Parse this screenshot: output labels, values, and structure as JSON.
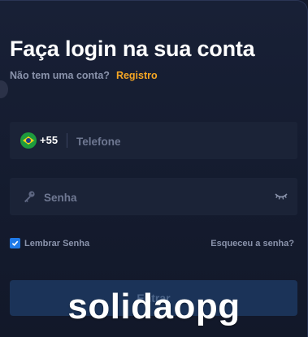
{
  "header": {
    "title": "Faça login na sua conta",
    "no_account_text": "Não tem uma conta?",
    "register_link": "Registro"
  },
  "phone_field": {
    "country_flag": "brazil-flag-icon",
    "dial_code": "+55",
    "placeholder": "Telefone"
  },
  "password_field": {
    "placeholder": "Senha",
    "lead_icon": "key-icon",
    "toggle_icon": "eye-closed-icon"
  },
  "options": {
    "remember_label": "Lembrar Senha",
    "remember_checked": true,
    "forgot_link": "Esqueceu a senha?"
  },
  "submit": {
    "label": "Entrar"
  },
  "watermark": "solidaopg",
  "colors": {
    "accent": "#f5a623",
    "checkbox": "#1f7ae8",
    "background": "#141a2c"
  }
}
